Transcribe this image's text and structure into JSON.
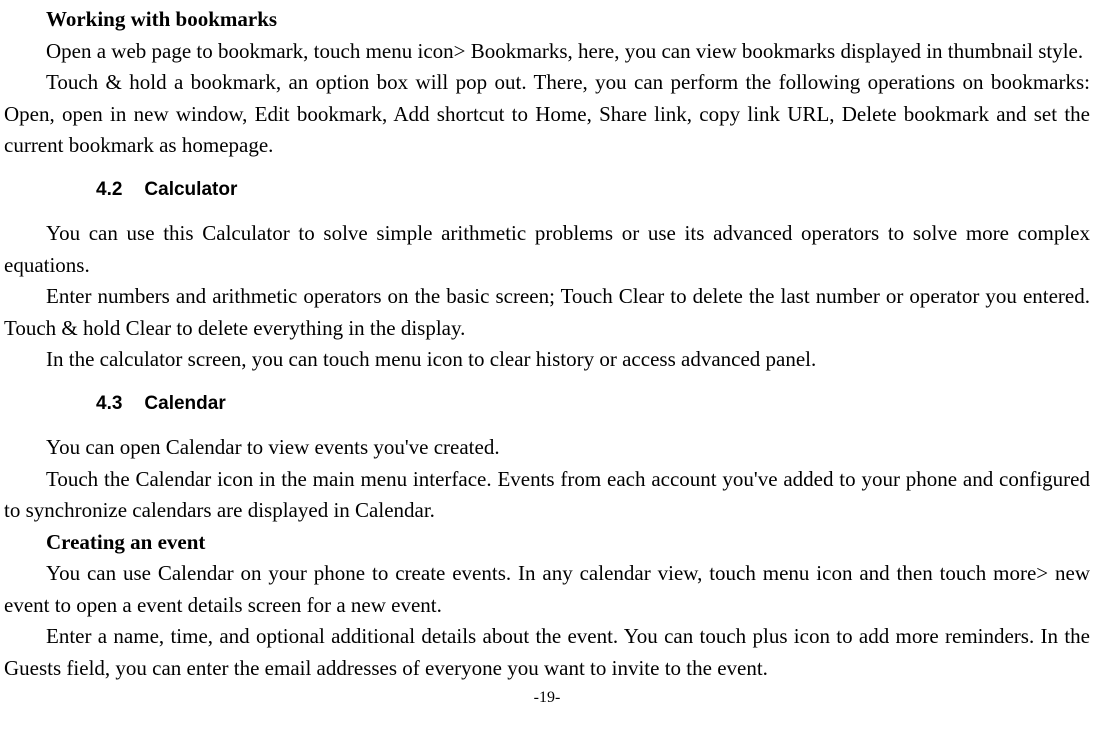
{
  "sections": {
    "bookmarks": {
      "heading": "Working with bookmarks",
      "p1": "Open a web page to bookmark, touch menu icon> Bookmarks, here, you can view bookmarks displayed in thumbnail style.",
      "p2": "Touch & hold a bookmark, an option box will pop out. There, you can perform the following operations on bookmarks: Open, open in new window, Edit bookmark, Add shortcut to Home, Share link, copy link URL, Delete bookmark and set the current bookmark as homepage."
    },
    "calculator": {
      "num": "4.2",
      "title": "Calculator",
      "p1": "You can use this Calculator to solve simple arithmetic problems or use its advanced operators to solve more complex equations.",
      "p2": "Enter numbers and arithmetic operators on the basic screen; Touch Clear to delete the last number or operator you entered. Touch & hold Clear to delete everything in the display.",
      "p3": "In the calculator screen, you can touch menu icon to clear history or access advanced panel."
    },
    "calendar": {
      "num": "4.3",
      "title": "Calendar",
      "p1": "You can open Calendar to view events you've created.",
      "p2": "Touch the Calendar icon in the main menu interface. Events from each account you've added to your phone and configured to synchronize calendars are displayed in Calendar.",
      "event_heading": "Creating an event",
      "p3": "You can use Calendar on your phone to create events. In any calendar view, touch menu icon and then touch more> new event to open a event details screen for a new event.",
      "p4": "Enter a name, time, and optional additional details about the event. You can touch plus icon to add more reminders. In the Guests field, you can enter the email addresses of everyone you want to invite to the event."
    }
  },
  "page_number": "-19-"
}
